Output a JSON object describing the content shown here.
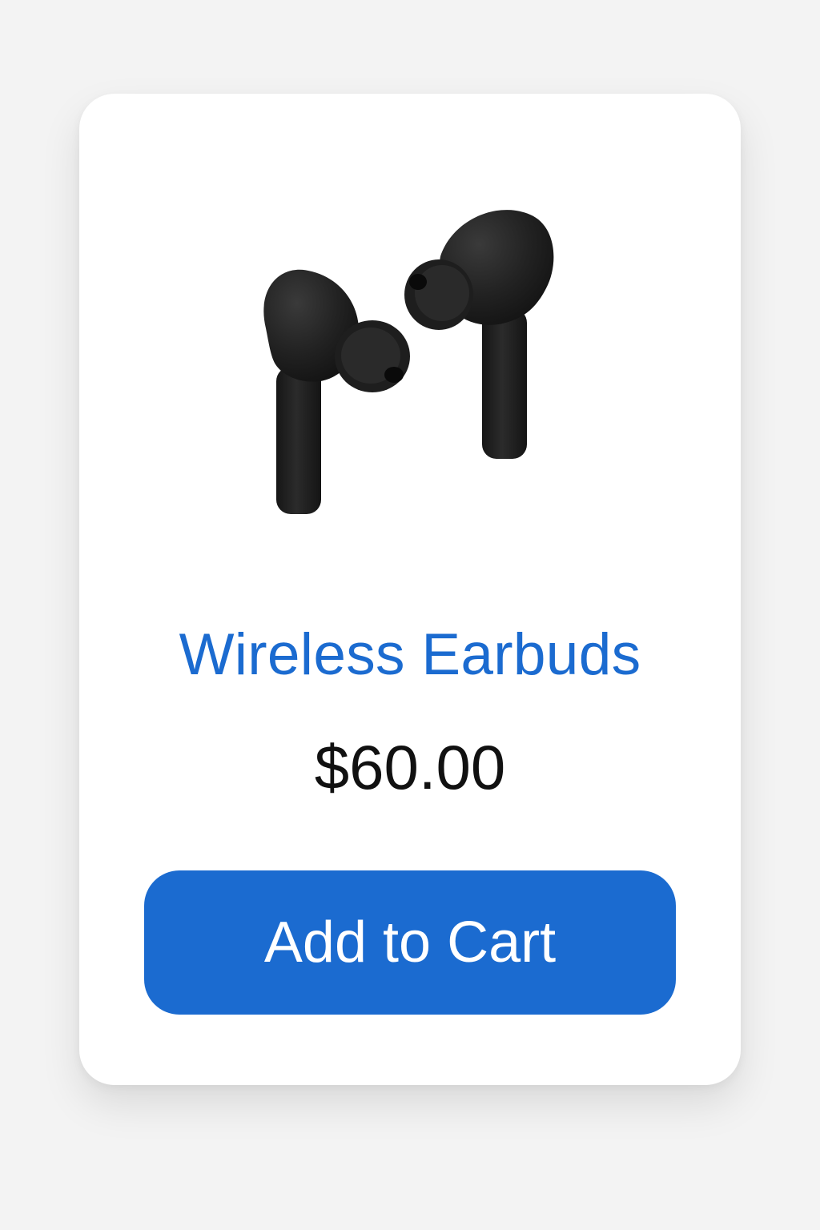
{
  "product": {
    "image_icon": "wireless-earbuds-image",
    "title": "Wireless Earbuds",
    "price": "$60.00"
  },
  "actions": {
    "add_to_cart_label": "Add to Cart"
  },
  "colors": {
    "background": "#f3f3f3",
    "card": "#ffffff",
    "accent": "#1b6bd0",
    "price_text": "#111111",
    "button_text": "#ffffff",
    "earbud": "#1c1c1c"
  }
}
